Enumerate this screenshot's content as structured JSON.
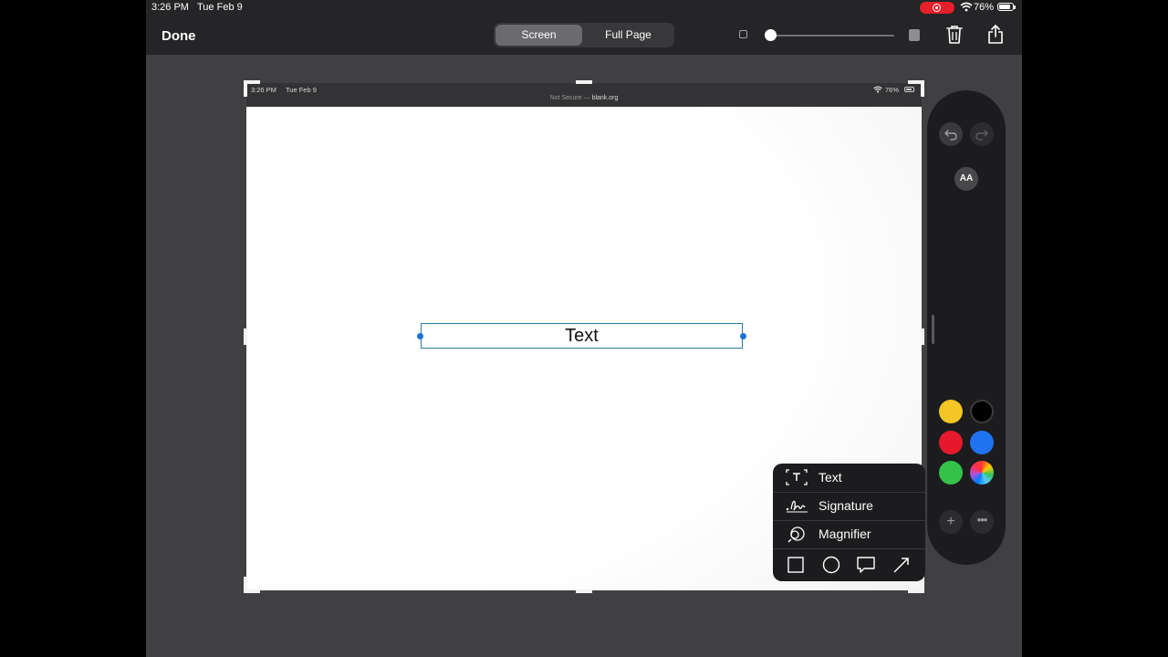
{
  "status_bar": {
    "time": "3:26 PM",
    "date": "Tue Feb 9",
    "battery": "76%",
    "recording": true
  },
  "toolbar": {
    "done_label": "Done",
    "segments": [
      {
        "label": "Screen",
        "selected": true
      },
      {
        "label": "Full Page",
        "selected": false
      }
    ],
    "zoom_level": 0.03
  },
  "screenshot": {
    "status_time": "3:26 PM",
    "status_date": "Tue Feb 9",
    "status_battery": "76%",
    "url_prefix": "Not Secure — ",
    "url_host": "blank.org"
  },
  "annotation": {
    "text": "Text"
  },
  "palette": {
    "aa_label": "AA",
    "colors": [
      "#f4c625",
      "#000000",
      "#e6192c",
      "#1f73f1",
      "#33c24a",
      "multicolor"
    ],
    "selected_color": "#000000"
  },
  "menu": {
    "items": [
      {
        "label": "Text",
        "icon": "text-box-icon"
      },
      {
        "label": "Signature",
        "icon": "signature-icon"
      },
      {
        "label": "Magnifier",
        "icon": "magnifier-icon"
      }
    ],
    "shapes": [
      "square-icon",
      "circle-icon",
      "speech-bubble-icon",
      "arrow-icon"
    ]
  }
}
